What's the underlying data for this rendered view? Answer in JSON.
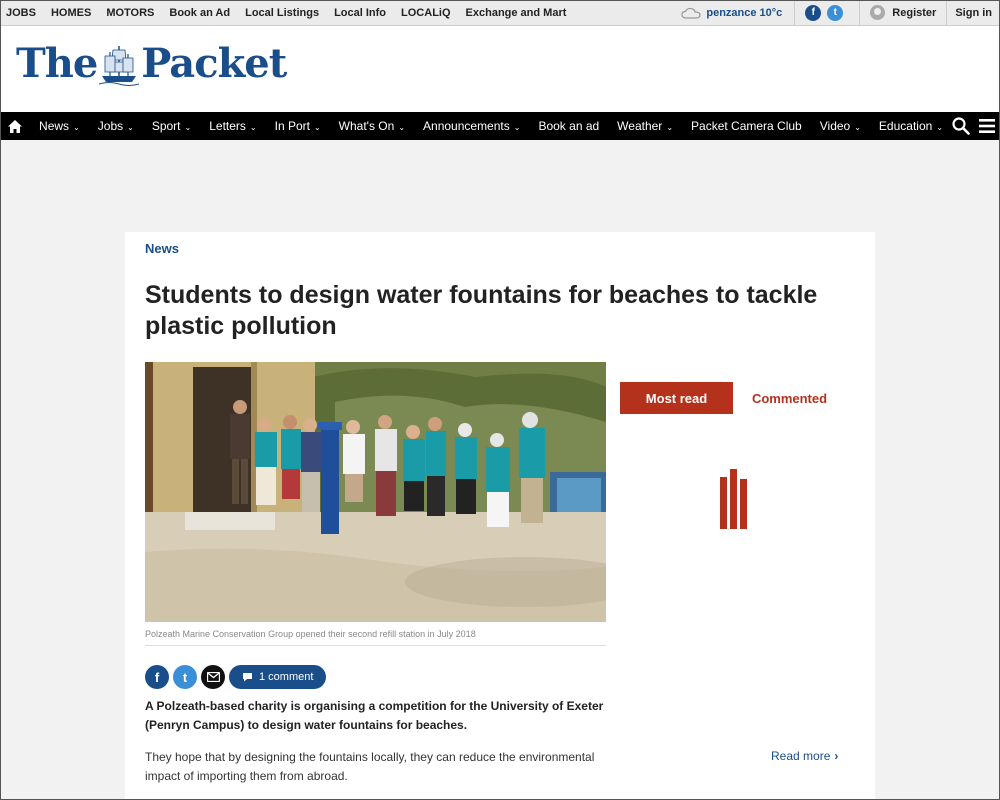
{
  "topbar": {
    "links": [
      "JOBS",
      "HOMES",
      "MOTORS",
      "Book an Ad",
      "Local Listings",
      "Local Info",
      "LOCALiQ",
      "Exchange and Mart"
    ],
    "weather": "penzance 10°c",
    "register": "Register",
    "signin": "Sign in"
  },
  "logo": {
    "left": "The",
    "right": "Packet"
  },
  "nav": {
    "items": [
      {
        "label": "News",
        "dropdown": true
      },
      {
        "label": "Jobs",
        "dropdown": true
      },
      {
        "label": "Sport",
        "dropdown": true
      },
      {
        "label": "Letters",
        "dropdown": true
      },
      {
        "label": "In Port",
        "dropdown": true
      },
      {
        "label": "What's On",
        "dropdown": true
      },
      {
        "label": "Announcements",
        "dropdown": true
      },
      {
        "label": "Book an ad",
        "dropdown": false
      },
      {
        "label": "Weather",
        "dropdown": true
      },
      {
        "label": "Packet Camera Club",
        "dropdown": false
      },
      {
        "label": "Video",
        "dropdown": true
      },
      {
        "label": "Education",
        "dropdown": true
      }
    ]
  },
  "article": {
    "section": "News",
    "headline": "Students to design water fountains for beaches to tackle plastic pollution",
    "caption": "Polzeath Marine Conservation Group opened their second refill station in July 2018",
    "comments": "1 comment",
    "lead": "A Polzeath-based charity is organising a competition for the University of Exeter (Penryn Campus) to design water fountains for beaches.",
    "body": "They hope that by designing the fountains locally, they can reduce the environmental impact of importing them from abroad."
  },
  "widget": {
    "tab_active": "Most read",
    "tab_inactive": "Commented",
    "read_more": "Read more"
  },
  "colors": {
    "brand_blue": "#1a4e8a",
    "accent_red": "#b4321c",
    "nav_bg": "#000000"
  }
}
